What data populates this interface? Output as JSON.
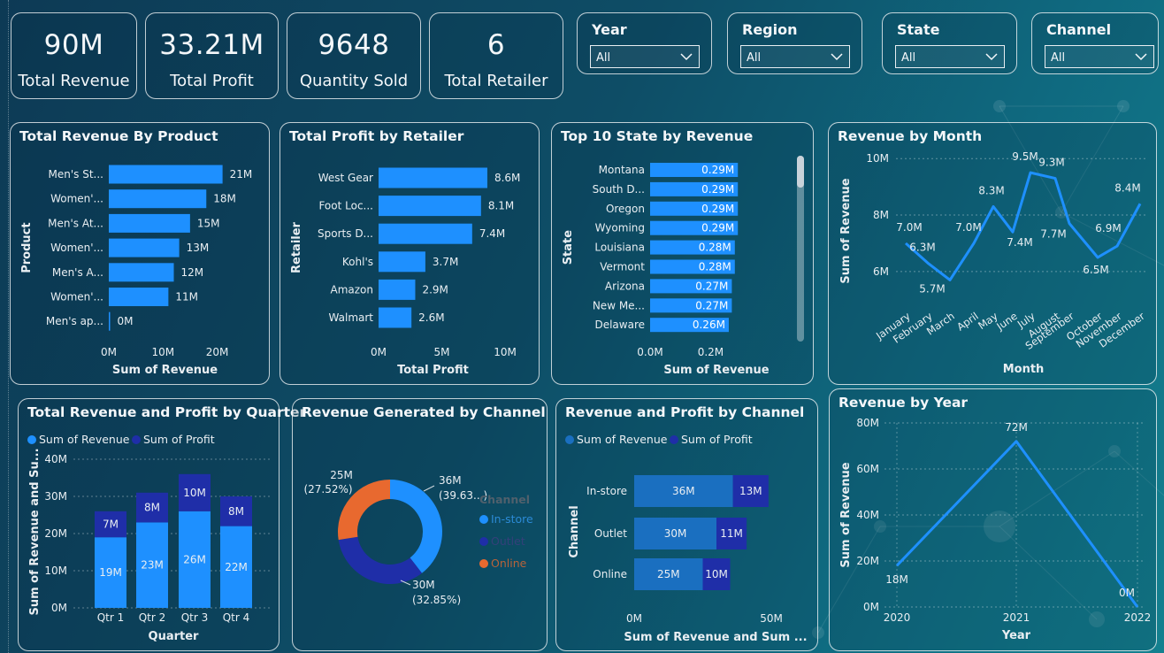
{
  "kpis": [
    {
      "value": "90M",
      "label": "Total Revenue"
    },
    {
      "value": "33.21M",
      "label": "Total Profit"
    },
    {
      "value": "9648",
      "label": "Quantity Sold"
    },
    {
      "value": "6",
      "label": "Total Retailer"
    }
  ],
  "slicers": [
    {
      "title": "Year",
      "value": "All"
    },
    {
      "title": "Region",
      "value": "All"
    },
    {
      "title": "State",
      "value": "All"
    },
    {
      "title": "Channel",
      "value": "All"
    }
  ],
  "colors": {
    "revenue": "#1e90ff",
    "profit": "#1f2ea8",
    "donut_instore": "#1e90ff",
    "donut_outlet": "#1f2ea8",
    "donut_online": "#e8692f",
    "line": "#1e90ff"
  },
  "chart_data": [
    {
      "id": "rev_by_product",
      "type": "bar",
      "title": "Total Revenue By Product",
      "xlabel": "Sum of Revenue",
      "ylabel": "Product",
      "categories": [
        "Men's St...",
        "Women'...",
        "Men's At...",
        "Women'...",
        "Men's A...",
        "Women'...",
        "Men's ap..."
      ],
      "values": [
        21,
        18,
        15,
        13,
        12,
        11,
        0.1
      ],
      "labels": [
        "21M",
        "18M",
        "15M",
        "13M",
        "12M",
        "11M",
        "0M"
      ],
      "xticks": [
        "0M",
        "10M",
        "20M"
      ],
      "xlim": [
        0,
        24
      ]
    },
    {
      "id": "profit_by_retailer",
      "type": "bar",
      "title": "Total Profit by Retailer",
      "xlabel": "Total Profit",
      "ylabel": "Retailer",
      "categories": [
        "West Gear",
        "Foot Loc...",
        "Sports D...",
        "Kohl's",
        "Amazon",
        "Walmart"
      ],
      "values": [
        8.6,
        8.1,
        7.4,
        3.7,
        2.9,
        2.6
      ],
      "labels": [
        "8.6M",
        "8.1M",
        "7.4M",
        "3.7M",
        "2.9M",
        "2.6M"
      ],
      "xticks": [
        "0M",
        "5M",
        "10M"
      ],
      "xlim": [
        0,
        10
      ]
    },
    {
      "id": "top10_state",
      "type": "bar",
      "title": "Top 10 State by Revenue",
      "xlabel": "Sum of Revenue",
      "ylabel": "State",
      "categories": [
        "Montana",
        "South D...",
        "Oregon",
        "Wyoming",
        "Louisiana",
        "Vermont",
        "Arizona",
        "New Me...",
        "Delaware"
      ],
      "values": [
        0.29,
        0.29,
        0.29,
        0.29,
        0.28,
        0.28,
        0.27,
        0.27,
        0.26
      ],
      "labels": [
        "0.29M",
        "0.29M",
        "0.29M",
        "0.29M",
        "0.28M",
        "0.28M",
        "0.27M",
        "0.27M",
        "0.26M"
      ],
      "xticks": [
        "0.0M",
        "0.2M"
      ],
      "xlim": [
        0,
        0.38
      ]
    },
    {
      "id": "rev_by_month",
      "type": "line",
      "title": "Revenue by Month",
      "xlabel": "Month",
      "ylabel": "Sum of Revenue",
      "categories": [
        "January",
        "February",
        "March",
        "April",
        "May",
        "June",
        "July",
        "August",
        "September",
        "October",
        "November",
        "December"
      ],
      "values": [
        7.0,
        6.3,
        5.7,
        7.0,
        8.3,
        7.4,
        9.5,
        9.3,
        7.7,
        6.5,
        6.9,
        8.4
      ],
      "labels": [
        "7.0M",
        "6.3M",
        "5.7M",
        "7.0M",
        "8.3M",
        "7.4M",
        "9.5M",
        "9.3M",
        "7.7M",
        "6.5M",
        "6.9M",
        "8.4M"
      ],
      "yticks": [
        "6M",
        "8M",
        "10M"
      ],
      "ylim": [
        5.4,
        10.1
      ]
    },
    {
      "id": "rev_profit_quarter",
      "type": "bar",
      "stacked": true,
      "title": "Total Revenue and Profit by Quarter",
      "xlabel": "Quarter",
      "ylabel": "Sum of Revenue and Su...",
      "categories": [
        "Qtr 1",
        "Qtr 2",
        "Qtr 3",
        "Qtr 4"
      ],
      "series": [
        {
          "name": "Sum of Revenue",
          "values": [
            19,
            23,
            26,
            22
          ],
          "labels": [
            "19M",
            "23M",
            "26M",
            "22M"
          ]
        },
        {
          "name": "Sum of Profit",
          "values": [
            7,
            8,
            10,
            8
          ],
          "labels": [
            "7M",
            "8M",
            "10M",
            "8M"
          ]
        }
      ],
      "yticks": [
        "0M",
        "10M",
        "20M",
        "30M",
        "40M"
      ],
      "ylim": [
        0,
        40
      ],
      "legend": "top-left"
    },
    {
      "id": "rev_by_channel",
      "type": "pie",
      "donut": true,
      "title": "Revenue Generated by Channel",
      "legend_title": "Channel",
      "categories": [
        "In-store",
        "Outlet",
        "Online"
      ],
      "values": [
        36,
        30,
        25
      ],
      "labels": [
        "36M",
        "30M",
        "25M"
      ],
      "pcts": [
        "(39.63...)",
        "(32.85%)",
        "(27.52%)"
      ],
      "legend": "right"
    },
    {
      "id": "rev_profit_channel",
      "type": "bar",
      "stacked": true,
      "orientation": "horizontal",
      "title": "Revenue and Profit by Channel",
      "xlabel": "Sum of Revenue and Sum ...",
      "ylabel": "Channel",
      "categories": [
        "In-store",
        "Outlet",
        "Online"
      ],
      "series": [
        {
          "name": "Sum of Revenue",
          "values": [
            36,
            30,
            25
          ],
          "labels": [
            "36M",
            "30M",
            "25M"
          ]
        },
        {
          "name": "Sum of Profit",
          "values": [
            13,
            11,
            10
          ],
          "labels": [
            "13M",
            "11M",
            "10M"
          ]
        }
      ],
      "xticks": [
        "0M",
        "50M"
      ],
      "xlim": [
        0,
        50
      ],
      "legend": "top-left"
    },
    {
      "id": "rev_by_year",
      "type": "line",
      "title": "Revenue by Year",
      "xlabel": "Year",
      "ylabel": "Sum of Revenue",
      "categories": [
        "2020",
        "2021",
        "2022"
      ],
      "values": [
        18,
        72,
        0
      ],
      "labels": [
        "18M",
        "72M",
        "0M"
      ],
      "yticks": [
        "0M",
        "20M",
        "40M",
        "60M",
        "80M"
      ],
      "ylim": [
        0,
        80
      ]
    }
  ]
}
